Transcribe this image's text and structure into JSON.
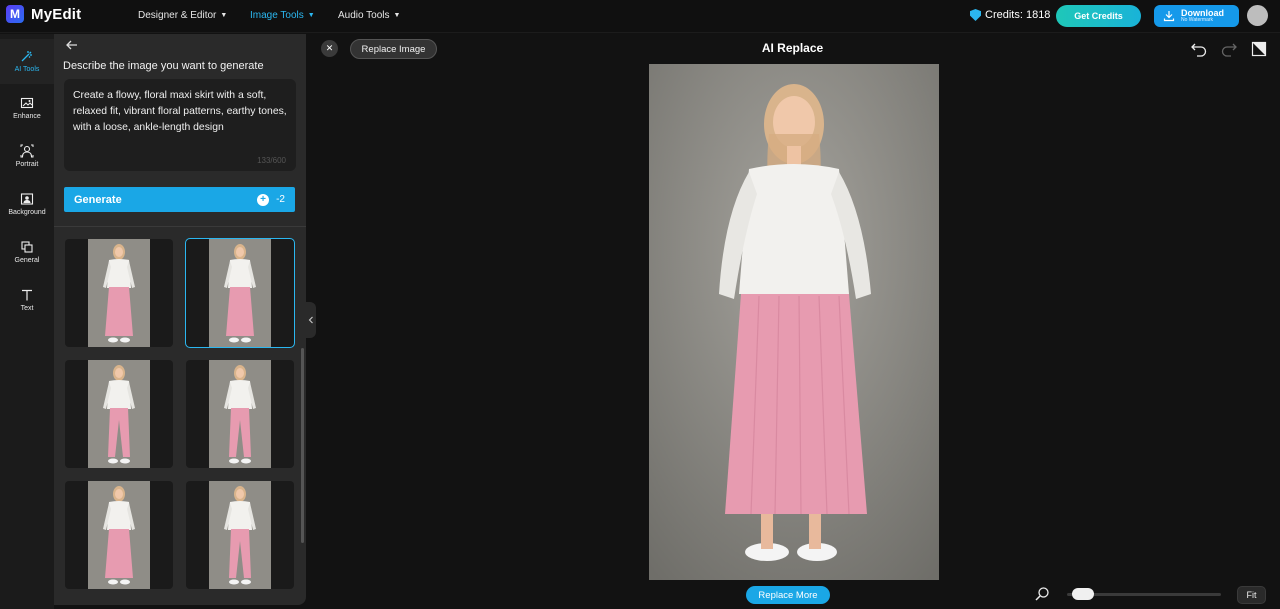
{
  "app": {
    "name": "MyEdit",
    "logo_letter": "M"
  },
  "nav": [
    {
      "label": "Designer & Editor",
      "active": false
    },
    {
      "label": "Image Tools",
      "active": true
    },
    {
      "label": "Audio Tools",
      "active": false
    }
  ],
  "header": {
    "credits_label": "Credits: 1818",
    "get_credits_label": "Get Credits",
    "download_label": "Download",
    "download_sublabel": "No Watermark"
  },
  "rail": [
    {
      "label": "AI Tools",
      "icon": "magic-wand-icon",
      "active": true
    },
    {
      "label": "Enhance",
      "icon": "enhance-icon",
      "active": false
    },
    {
      "label": "Portrait",
      "icon": "portrait-icon",
      "active": false
    },
    {
      "label": "Background",
      "icon": "background-icon",
      "active": false
    },
    {
      "label": "General",
      "icon": "general-icon",
      "active": false
    },
    {
      "label": "Text",
      "icon": "text-icon",
      "active": false
    }
  ],
  "panel": {
    "title": "Describe the image you want to generate",
    "prompt": "Create a flowy, floral maxi skirt with a soft, relaxed fit, vibrant floral patterns, earthy tones, with a loose, ankle-length design",
    "counter": "133/600",
    "generate_label": "Generate",
    "generate_cost": "-2",
    "results": [
      {
        "variant": "skirt",
        "selected": false
      },
      {
        "variant": "skirt",
        "selected": true
      },
      {
        "variant": "pants",
        "selected": false
      },
      {
        "variant": "pants",
        "selected": false
      },
      {
        "variant": "skirt",
        "selected": false
      },
      {
        "variant": "pants",
        "selected": false
      }
    ]
  },
  "canvas": {
    "title": "AI Replace",
    "replace_image_label": "Replace Image",
    "replace_more_label": "Replace More",
    "fit_label": "Fit",
    "zoom_level": 0.05
  },
  "colors": {
    "accent": "#2bb7f0",
    "button_blue": "#1aa7e6",
    "skirt": "#e79bb0",
    "top": "#f2f1ee",
    "backdrop": "#8f8d87"
  }
}
